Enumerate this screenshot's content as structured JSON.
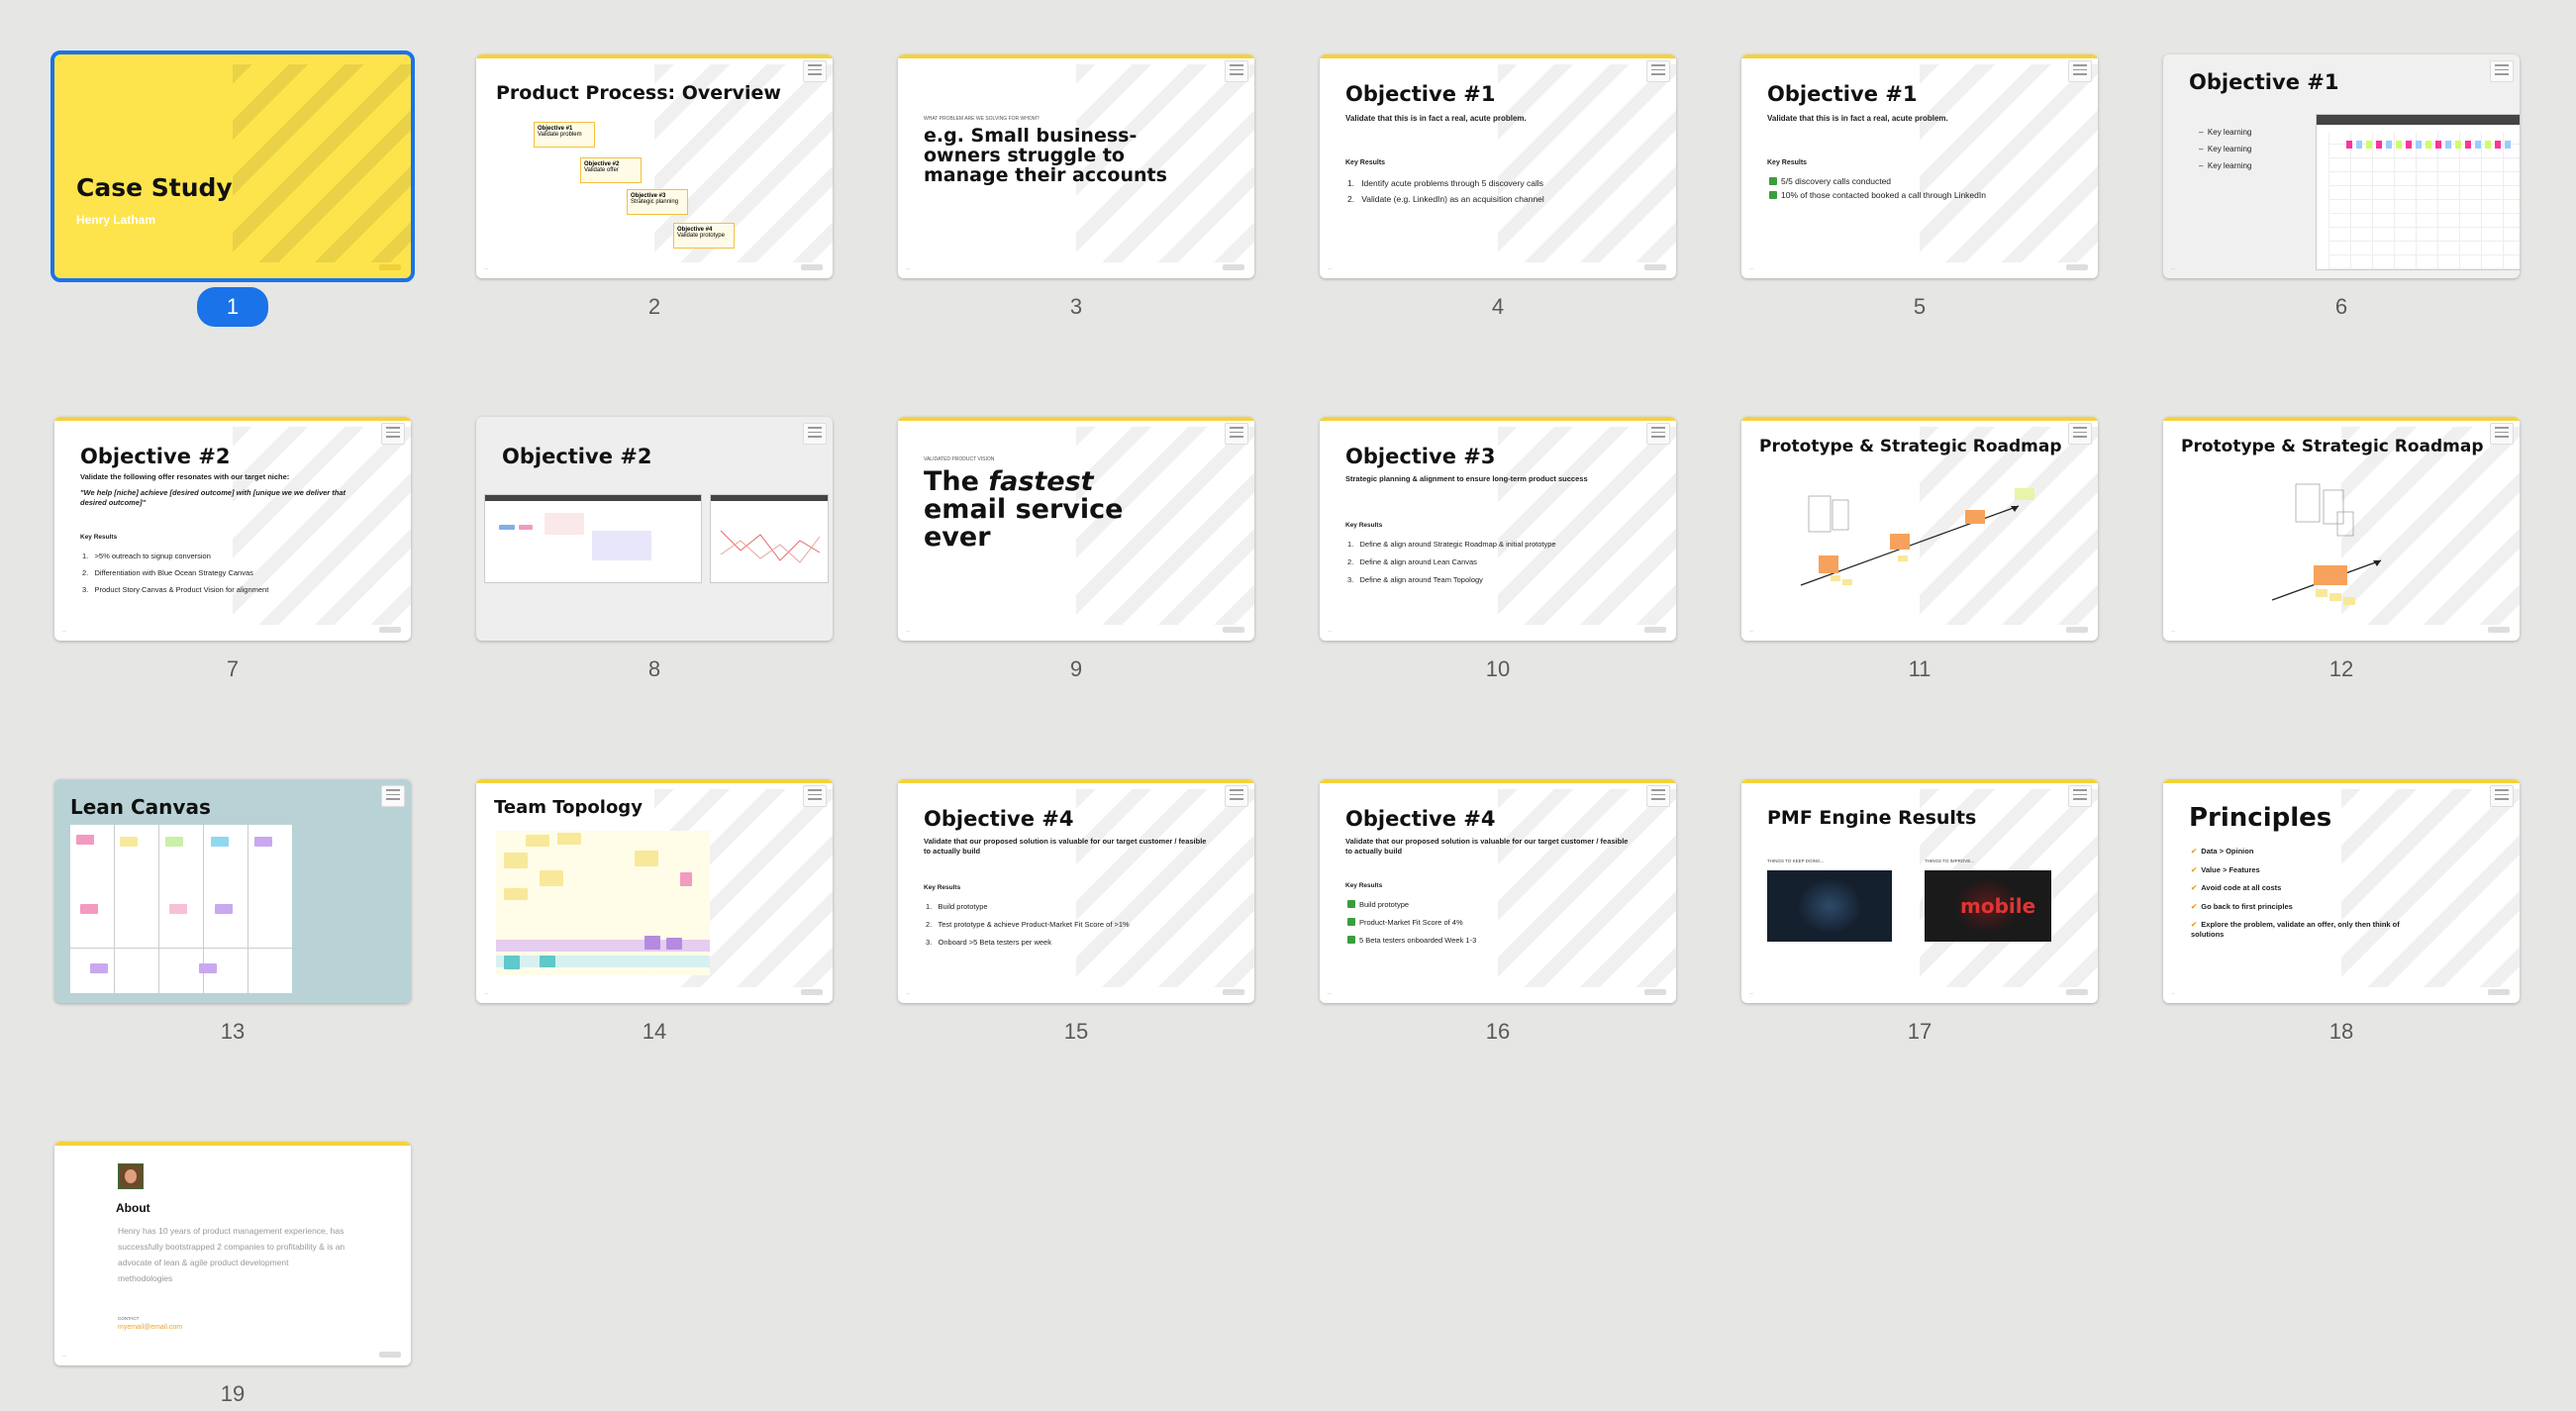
{
  "selected_slide": 1,
  "slides": [
    {
      "num": "1",
      "title": "Case Study",
      "subtitle": "Henry Latham"
    },
    {
      "num": "2",
      "title": "Product Process: Overview",
      "steps": [
        {
          "label": "Objective #1",
          "sub": "Validate problem"
        },
        {
          "label": "Objective #2",
          "sub": "Validate offer"
        },
        {
          "label": "Objective #3",
          "sub": "Strategic planning"
        },
        {
          "label": "Objective #4",
          "sub": "Validate prototype"
        }
      ]
    },
    {
      "num": "3",
      "kicker": "WHAT PROBLEM ARE WE SOLVING FOR WHOM?",
      "title": "e.g. Small business-owners struggle to manage their accounts"
    },
    {
      "num": "4",
      "title": "Objective #1",
      "subtitle": "Validate that this is in fact a real, acute problem.",
      "kr_label": "Key Results",
      "items": [
        "Identify acute problems through 5 discovery calls",
        "Validate (e.g. LinkedIn) as an acquisition channel"
      ]
    },
    {
      "num": "5",
      "title": "Objective #1",
      "subtitle": "Validate that this is in fact a real, acute problem.",
      "kr_label": "Key Results",
      "items": [
        "5/5 discovery calls conducted",
        "10% of those contacted booked a call through LinkedIn"
      ]
    },
    {
      "num": "6",
      "title": "Objective #1",
      "items": [
        "Key learning",
        "Key learning",
        "Key learning"
      ]
    },
    {
      "num": "7",
      "title": "Objective #2",
      "subtitle": "Validate the following offer resonates with our target niche:",
      "quote": "\"We help [niche] achieve [desired outcome] with [unique we we deliver that desired outcome]\"",
      "kr_label": "Key Results",
      "items": [
        ">5% outreach to signup conversion",
        "Differentiation with Blue Ocean Strategy Canvas",
        "Product Story Canvas & Product Vision for alignment"
      ]
    },
    {
      "num": "8",
      "title": "Objective #2"
    },
    {
      "num": "9",
      "kicker": "VALIDATED PRODUCT VISION",
      "title_pre": "The ",
      "title_em": "fastest",
      "title_post": " email service ever"
    },
    {
      "num": "10",
      "title": "Objective #3",
      "subtitle": "Strategic planning & alignment to ensure long-term product success",
      "kr_label": "Key Results",
      "items": [
        "Define & align around Strategic Roadmap & initial prototype",
        "Define & align around Lean Canvas",
        "Define & align around Team Topology"
      ]
    },
    {
      "num": "11",
      "title": "Prototype & Strategic Roadmap"
    },
    {
      "num": "12",
      "title": "Prototype & Strategic Roadmap"
    },
    {
      "num": "13",
      "title": "Lean Canvas"
    },
    {
      "num": "14",
      "title": "Team Topology"
    },
    {
      "num": "15",
      "title": "Objective #4",
      "subtitle": "Validate that our proposed solution is valuable for our target customer / feasible to actually build",
      "kr_label": "Key Results",
      "items": [
        "Build prototype",
        "Test prototype & achieve Product-Market Fit Score of >1%",
        "Onboard >5 Beta testers per week"
      ]
    },
    {
      "num": "16",
      "title": "Objective #4",
      "subtitle": "Validate that our proposed solution is valuable for our target customer / feasible to actually build",
      "kr_label": "Key Results",
      "items": [
        "Build prototype",
        "Product-Market Fit Score of 4%",
        "5 Beta testers onboarded Week 1-3"
      ]
    },
    {
      "num": "17",
      "title": "PMF Engine Results",
      "left_label": "THINGS TO KEEP DOING...",
      "right_label": "THINGS TO IMPROVE...",
      "right_word": "mobile"
    },
    {
      "num": "18",
      "title": "Principles",
      "items": [
        "Data > Opinion",
        "Value > Features",
        "Avoid code at all costs",
        "Go back to first principles",
        "Explore the problem, validate an offer, only then think of solutions"
      ]
    },
    {
      "num": "19",
      "title": "About",
      "body": "Henry has 10 years of product management experience, has successfully bootstrapped 2 companies to profitability & is an advocate of lean & agile product development methodologies",
      "contact_label": "CONTACT",
      "email": "myemail@email.com"
    }
  ],
  "colors": {
    "accent": "#1a73e8",
    "yellow": "#fde44d",
    "bar": "#f4d23a",
    "canvas_bg": "#b9d2d6"
  }
}
